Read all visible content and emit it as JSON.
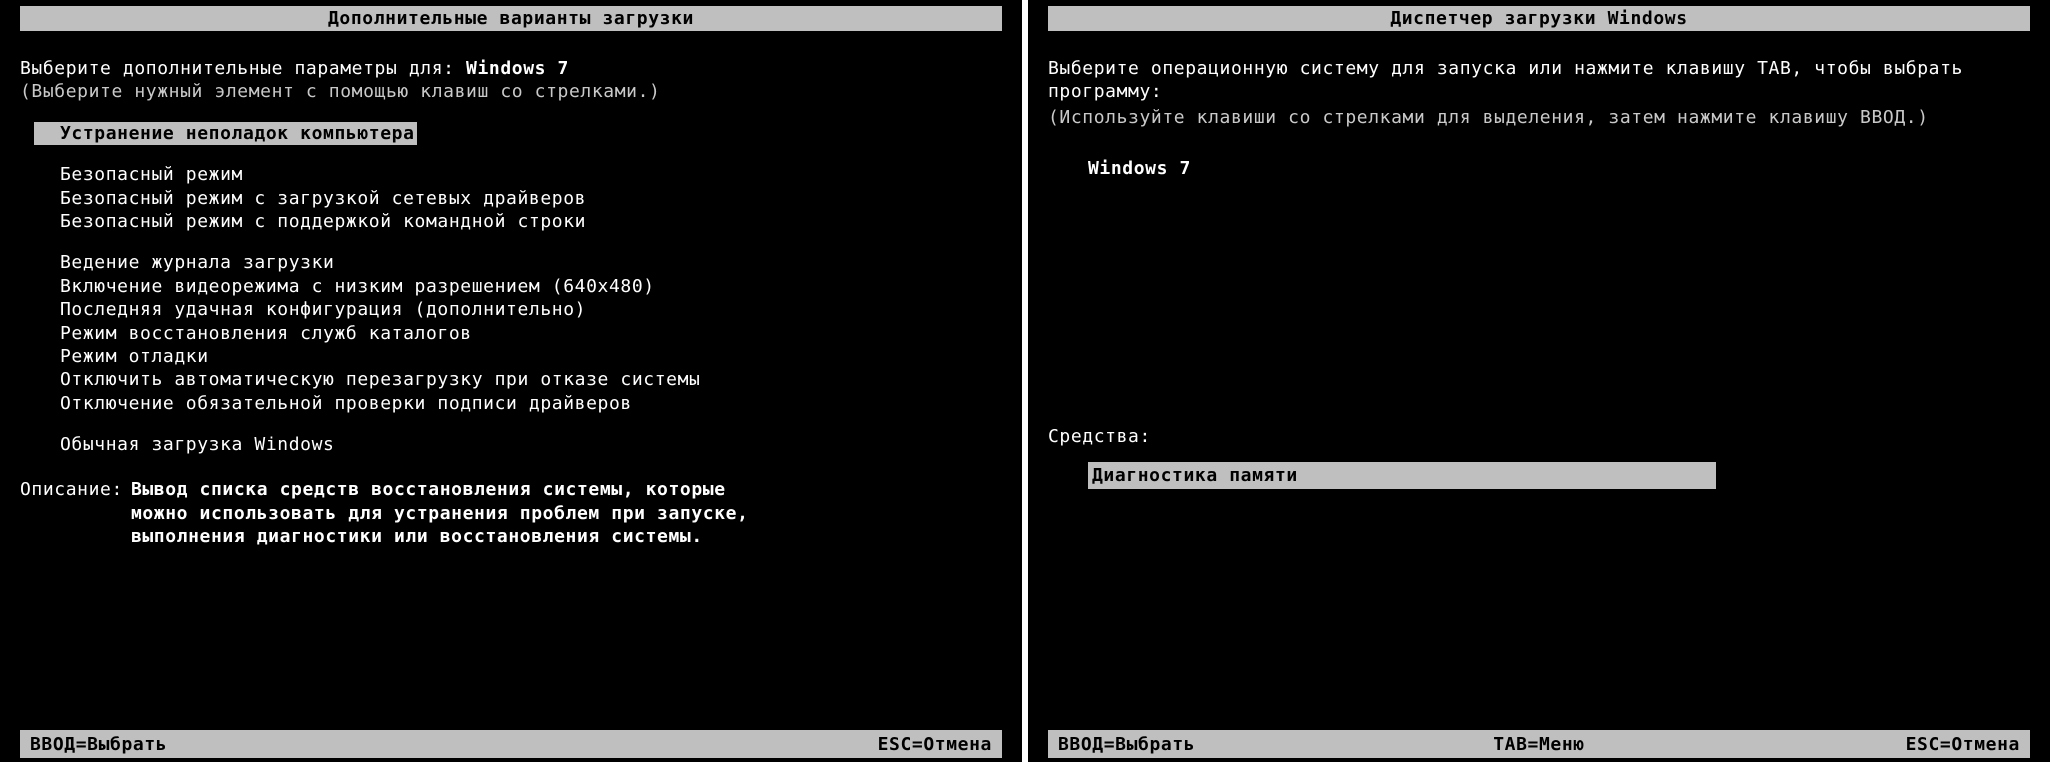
{
  "left": {
    "title": "Дополнительные варианты загрузки",
    "instruct_prefix": "Выберите дополнительные параметры для:",
    "instruct_target": "Windows 7",
    "instruct_hint": "(Выберите нужный элемент с помощью клавиш со стрелками.)",
    "selected": "Устранение неполадок компьютера",
    "group1": [
      "Безопасный режим",
      "Безопасный режим с загрузкой сетевых драйверов",
      "Безопасный режим с поддержкой командной строки"
    ],
    "group2": [
      "Ведение журнала загрузки",
      "Включение видеорежима с низким разрешением (640x480)",
      "Последняя удачная конфигурация (дополнительно)",
      "Режим восстановления служб каталогов",
      "Режим отладки",
      "Отключить автоматическую перезагрузку при отказе системы",
      "Отключение обязательной проверки подписи драйверов"
    ],
    "group3": [
      "Обычная загрузка Windows"
    ],
    "desc_label": "Описание:",
    "desc_text": "Вывод списка средств восстановления системы, которые можно использовать для устранения проблем при запуске, выполнения диагностики или восстановления системы.",
    "footer_enter": "ВВОД=Выбрать",
    "footer_esc": "ESC=Отмена"
  },
  "right": {
    "title": "Диспетчер загрузки Windows",
    "instruct1": "Выберите операционную систему для запуска или нажмите клавишу TAB, чтобы выбрать программу:",
    "instruct2": "(Используйте клавиши со стрелками для выделения, затем нажмите клавишу ВВОД.)",
    "os_items": [
      "Windows 7"
    ],
    "tools_label": "Средства:",
    "tool_items": [
      "Диагностика памяти"
    ],
    "footer_enter": "ВВОД=Выбрать",
    "footer_tab": "TAB=Меню",
    "footer_esc": "ESC=Отмена"
  }
}
